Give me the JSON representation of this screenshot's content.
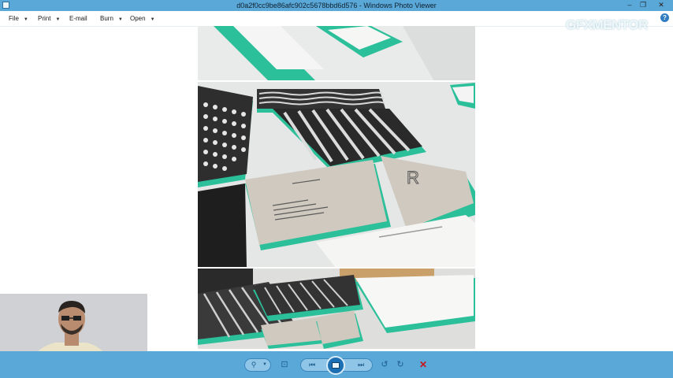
{
  "window": {
    "title": "d0a2f0cc9be86afc902c5678bbd6d576 - Windows Photo Viewer",
    "minimize_glyph": "–",
    "maximize_glyph": "❐",
    "close_glyph": "✕"
  },
  "menu": {
    "items": [
      {
        "label": "File",
        "has_dropdown": true
      },
      {
        "label": "Print",
        "has_dropdown": true
      },
      {
        "label": "E-mail",
        "has_dropdown": false
      },
      {
        "label": "Burn",
        "has_dropdown": true
      },
      {
        "label": "Open",
        "has_dropdown": true
      }
    ],
    "caret_glyph": "▼",
    "help_glyph": "?"
  },
  "watermark": {
    "text": "GFXMENTOR"
  },
  "photo": {
    "description_icon": "image-content",
    "accent_color": "#2bbf9a",
    "card_color": "#cfc9bf"
  },
  "toolbar": {
    "zoom_glyph": "⚲",
    "actual_size_glyph": "⊡",
    "previous_glyph": "⏮",
    "next_glyph": "⏭",
    "rotate_ccw_glyph": "↺",
    "rotate_cw_glyph": "↻",
    "delete_glyph": "✕",
    "colors": {
      "bar": "#5aa8d8",
      "delete": "#c8151b"
    }
  }
}
